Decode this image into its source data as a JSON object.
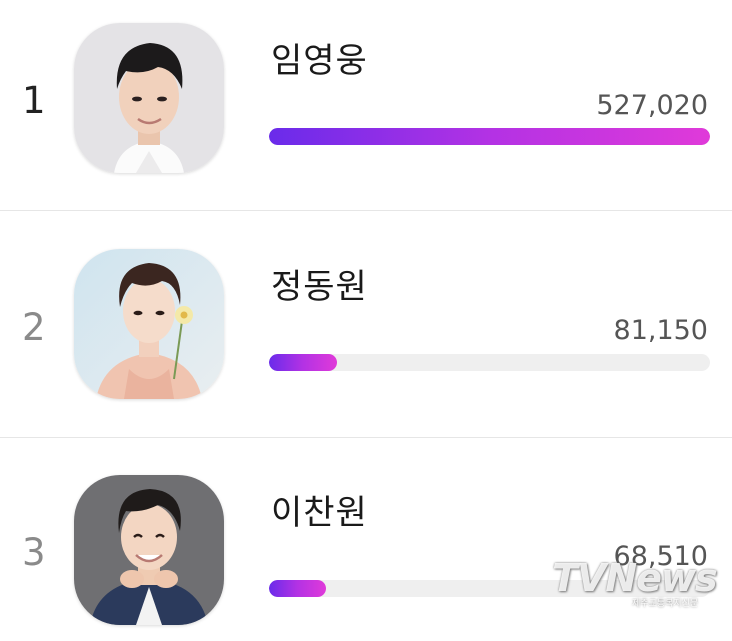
{
  "ranking": [
    {
      "rank": "1",
      "name": "임영웅",
      "votes": "527,020",
      "bar_fraction": 1.0,
      "avatar": "singer-portrait-white-shirt"
    },
    {
      "rank": "2",
      "name": "정동원",
      "votes": "81,150",
      "bar_fraction": 0.154,
      "avatar": "singer-portrait-holding-flower"
    },
    {
      "rank": "3",
      "name": "이찬원",
      "votes": "68,510",
      "bar_fraction": 0.13,
      "avatar": "singer-portrait-navy-suit"
    }
  ],
  "watermark": {
    "logo": "TVNews",
    "tagline": "제주교통복지신문"
  },
  "colors": {
    "bar_start": "#6a2bea",
    "bar_end": "#e03ad9",
    "track": "#efefef",
    "divider": "#e6e6e6"
  }
}
